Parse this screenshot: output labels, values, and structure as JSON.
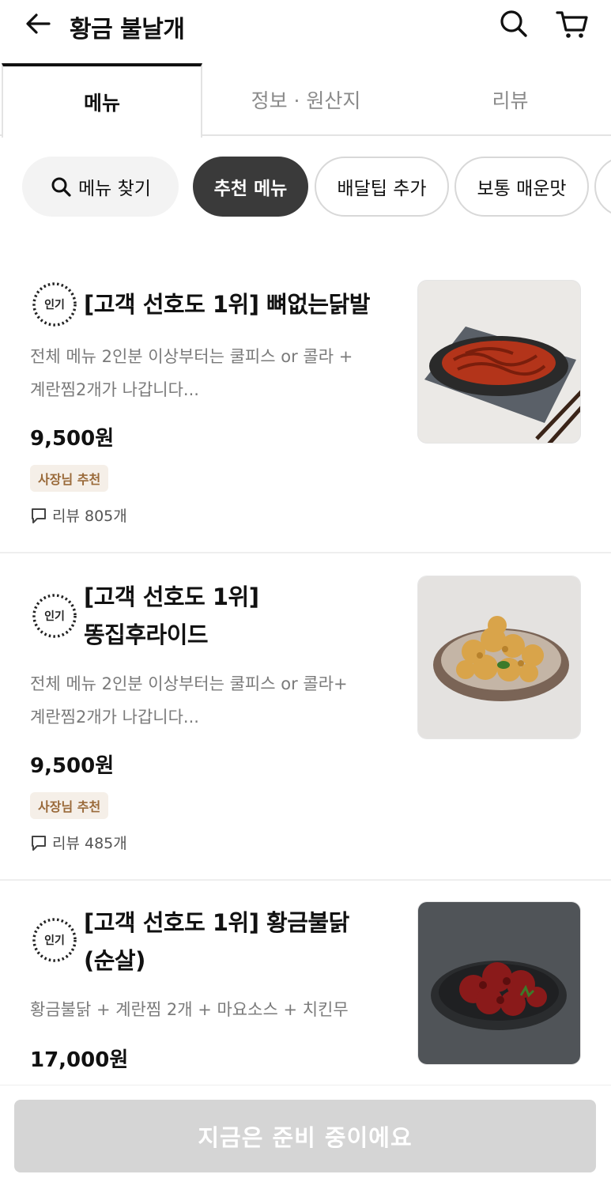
{
  "header": {
    "title": "황금 불날개"
  },
  "tabs": [
    {
      "label": "메뉴",
      "active": true
    },
    {
      "label": "정보 · 원산지",
      "active": false
    },
    {
      "label": "리뷰",
      "active": false
    }
  ],
  "chips": {
    "search_label": "메뉴 찾기",
    "items": [
      "추천 메뉴",
      "배달팁 추가",
      "보통 매운맛",
      ""
    ]
  },
  "menu": [
    {
      "badge": "인기",
      "name_line1": "[고객 선호도 1위]  뼈없는닭발",
      "name_line2": "",
      "desc_line1": "전체 메뉴 2인분 이상부터는 쿨피스 or 콜라 +",
      "desc_line2": "계란찜2개가 나갑니다...",
      "price": "9,500원",
      "tag": "사장님 추천",
      "review": "리뷰 805개"
    },
    {
      "badge": "인기",
      "name_line1": "[고객 선호도 1위]",
      "name_line2": "똥집후라이드",
      "desc_line1": "전체 메뉴 2인분 이상부터는 쿨피스  or 콜라+",
      "desc_line2": "계란찜2개가 나갑니다...",
      "price": "9,500원",
      "tag": "사장님 추천",
      "review": "리뷰 485개"
    },
    {
      "badge": "인기",
      "name_line1": "[고객 선호도 1위]  황금불닭",
      "name_line2": "(순살)",
      "desc_line1": "황금불닭 + 계란찜 2개 + 마요소스 + 치킨무",
      "price": "17,000원"
    }
  ],
  "bottom": {
    "cta_label": "지금은 준비 중이에요"
  },
  "colors": {
    "accent": "#3a3a3a",
    "tag_bg": "#f5efe8",
    "tag_text": "#9a6a3a",
    "cta_disabled": "#d5d5d5"
  }
}
